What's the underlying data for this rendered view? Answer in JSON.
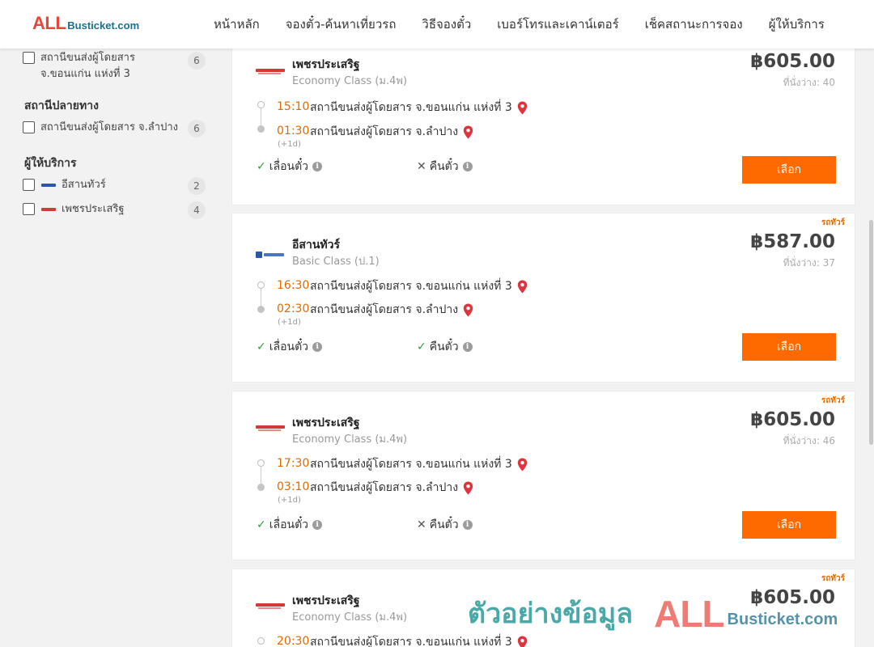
{
  "header": {
    "logo_all": "ALL",
    "logo_rest": "Busticket.com",
    "nav": [
      "หน้าหลัก",
      "จองตั๋ว-ค้นหาเที่ยวรถ",
      "วิธีจองตั๋ว",
      "เบอร์โทรและเคาน์เตอร์",
      "เช็คสถานะการจอง",
      "ผู้ให้บริการ"
    ]
  },
  "sidebar": {
    "origin_items": [
      {
        "label": "สถานีขนส่งผู้โดยสาร จ.ขอนแก่น แห่งที่ 3",
        "count": "6"
      }
    ],
    "destination_title": "สถานีปลายทาง",
    "destination_items": [
      {
        "label": "สถานีขนส่งผู้โดยสาร จ.ลำปาง",
        "count": "6"
      }
    ],
    "operator_title": "ผู้ให้บริการ",
    "operator_items": [
      {
        "label": "อีสานทัวร์",
        "count": "2"
      },
      {
        "label": "เพชรประเสริฐ",
        "count": "4"
      }
    ]
  },
  "common": {
    "select_label": "เลือก",
    "postpone_label": "เลื่อนตั๋ว",
    "refund_label": "คืนตั๋ว",
    "plus_day": "(+1d)",
    "tour_tag": "รถทัวร์",
    "info_glyph": "i"
  },
  "trips": [
    {
      "operator": "เพชรประเสริฐ",
      "bus_class": "Economy Class (ม.4พ)",
      "price": "฿605.00",
      "seats": "ที่นั่งว่าง: 40",
      "depart_time": "15:10",
      "depart_station": "สถานีขนส่งผู้โดยสาร จ.ขอนแก่น แห่งที่ 3",
      "arrive_time": "01:30",
      "arrive_station": "สถานีขนส่งผู้โดยสาร จ.ลำปาง",
      "refundable": false
    },
    {
      "operator": "อีสานทัวร์",
      "bus_class": "Basic Class (ป.1)",
      "price": "฿587.00",
      "seats": "ที่นั่งว่าง: 37",
      "depart_time": "16:30",
      "depart_station": "สถานีขนส่งผู้โดยสาร จ.ขอนแก่น แห่งที่ 3",
      "arrive_time": "02:30",
      "arrive_station": "สถานีขนส่งผู้โดยสาร จ.ลำปาง",
      "refundable": true
    },
    {
      "operator": "เพชรประเสริฐ",
      "bus_class": "Economy Class (ม.4พ)",
      "price": "฿605.00",
      "seats": "ที่นั่งว่าง: 46",
      "depart_time": "17:30",
      "depart_station": "สถานีขนส่งผู้โดยสาร จ.ขอนแก่น แห่งที่ 3",
      "arrive_time": "03:10",
      "arrive_station": "สถานีขนส่งผู้โดยสาร จ.ลำปาง",
      "refundable": false
    },
    {
      "operator": "เพชรประเสริฐ",
      "bus_class": "Economy Class (ม.4พ)",
      "price": "฿605.00",
      "depart_time": "20:30",
      "depart_station": "สถานีขนส่งผู้โดยสาร จ.ขอนแก่น แห่งที่ 3"
    }
  ],
  "watermark": {
    "thai": "ตัวอย่างข้อมูล",
    "all": "ALL",
    "rest": "Busticket.com"
  },
  "colors": {
    "accent": "#ff6a00",
    "time": "#e06a00",
    "brand_red": "#e8443a",
    "brand_blue": "#1d6f8f",
    "check": "#2e9d3a"
  }
}
